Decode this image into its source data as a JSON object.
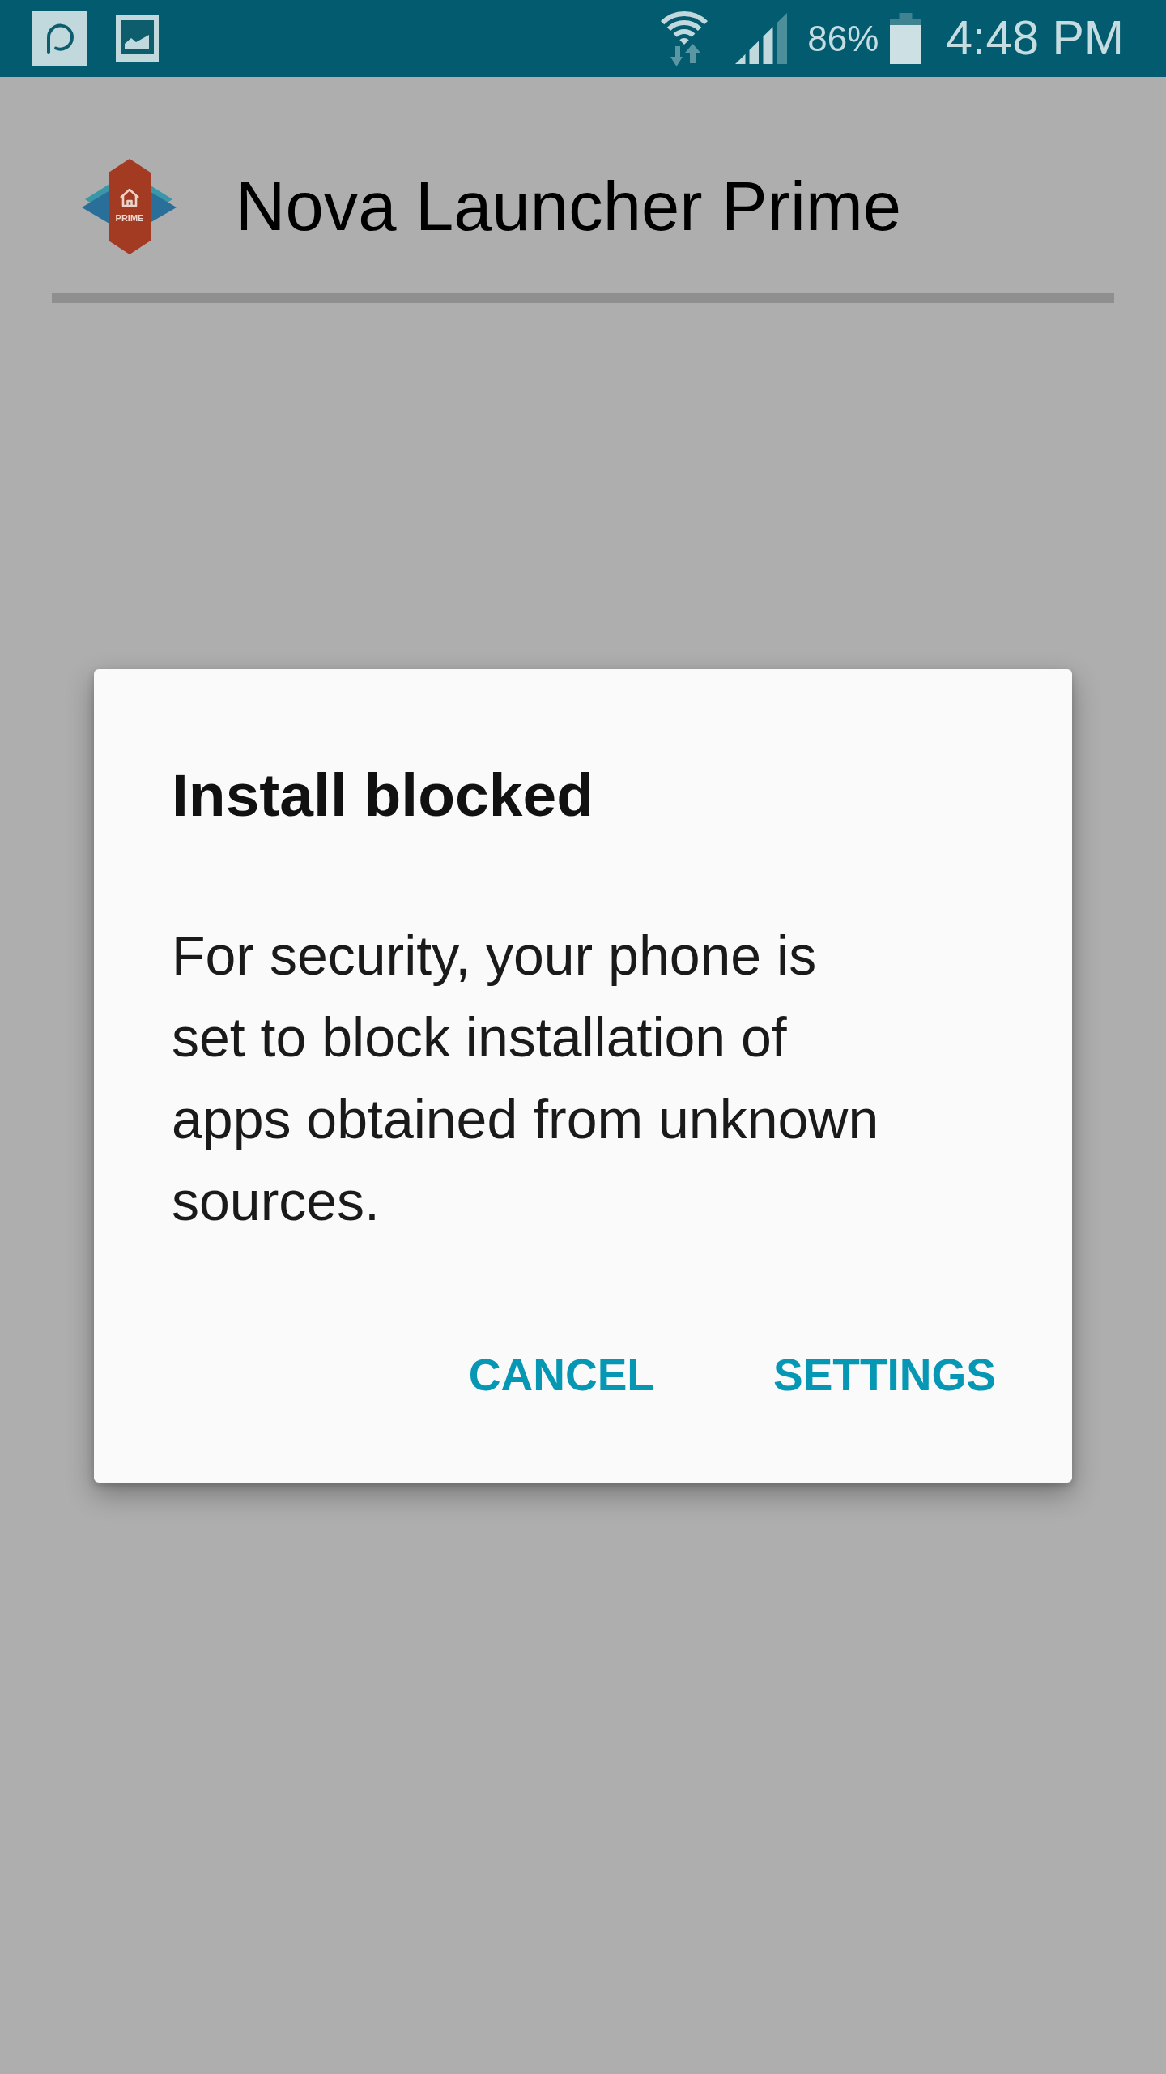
{
  "status_bar": {
    "battery": "86%",
    "time": "4:48 PM"
  },
  "app": {
    "title": "Nova Launcher Prime",
    "logo_label": "PRIME"
  },
  "dialog": {
    "title": "Install blocked",
    "message": "For security, your phone is set to block installation of apps obtained from unknown sources.",
    "buttons": [
      {
        "label": "CANCEL"
      },
      {
        "label": "SETTINGS"
      }
    ]
  }
}
